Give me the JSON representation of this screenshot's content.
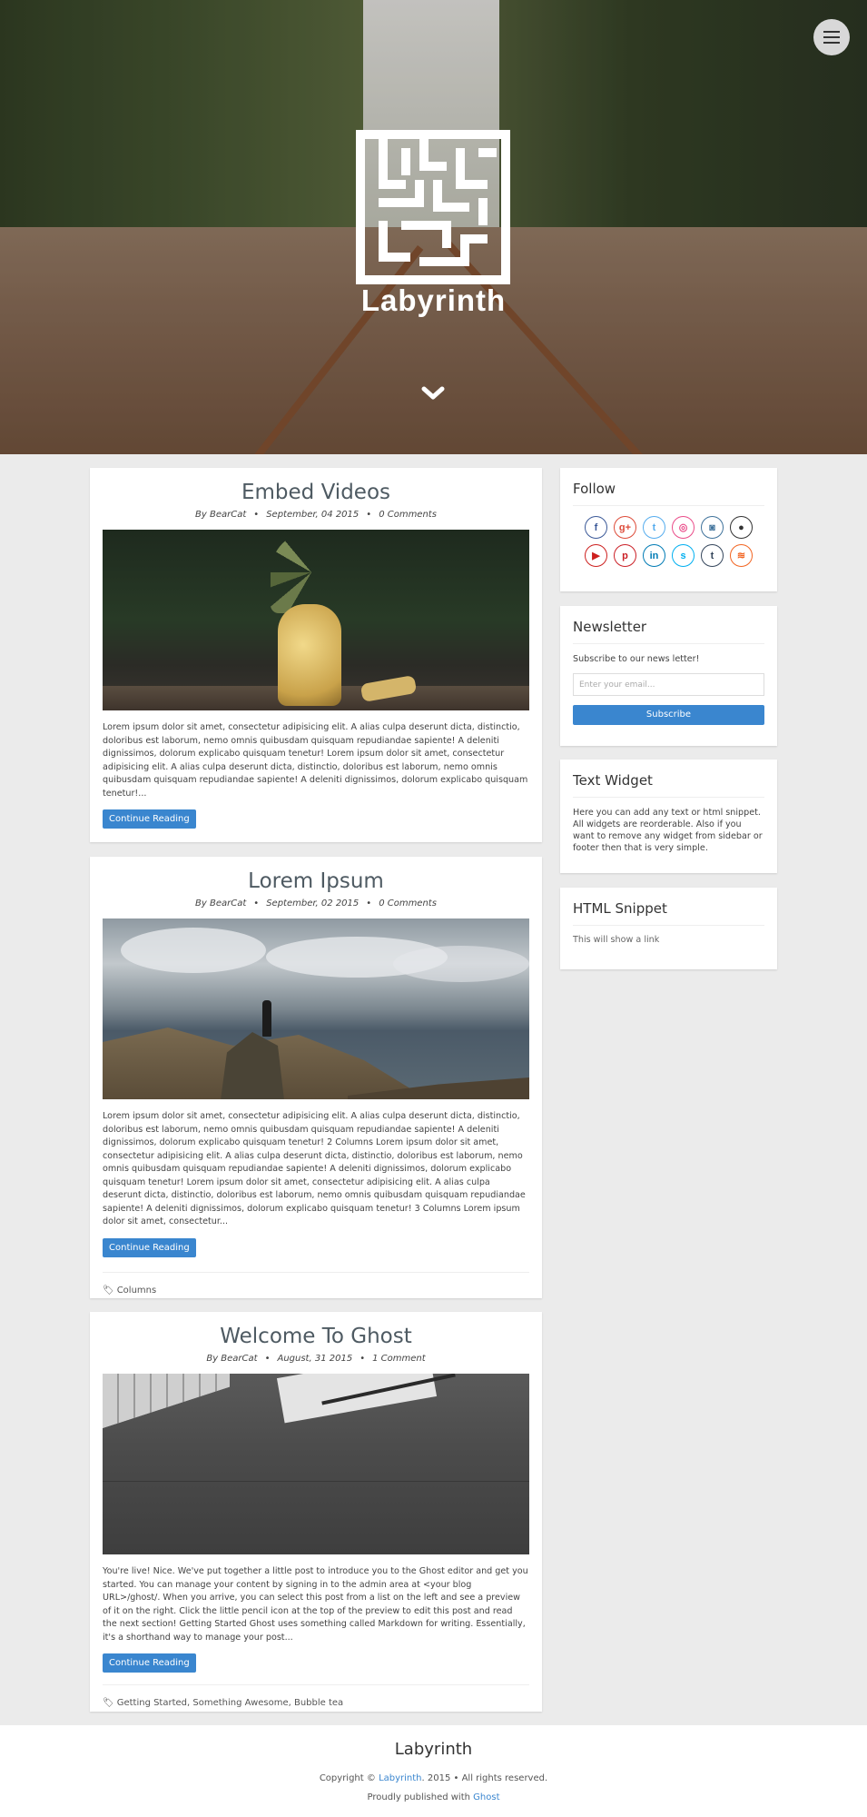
{
  "site": {
    "brand": "Labyrinth"
  },
  "posts": [
    {
      "title": "Embed Videos",
      "author": "By BearCat",
      "date": "September, 04 2015",
      "comments": "0 Comments",
      "excerpt": "Lorem ipsum dolor sit amet, consectetur adipisicing elit. A alias culpa deserunt dicta, distinctio, doloribus est laborum, nemo omnis quibusdam quisquam repudiandae sapiente! A deleniti dignissimos, dolorum explicabo quisquam tenetur! Lorem ipsum dolor sit amet, consectetur adipisicing elit. A alias culpa deserunt dicta, distinctio, doloribus est laborum, nemo omnis quibusdam quisquam repudiandae sapiente! A deleniti dignissimos, dolorum explicabo quisquam tenetur!...",
      "button": "Continue Reading"
    },
    {
      "title": "Lorem Ipsum",
      "author": "By BearCat",
      "date": "September, 02 2015",
      "comments": "0 Comments",
      "excerpt": "Lorem ipsum dolor sit amet, consectetur adipisicing elit. A alias culpa deserunt dicta, distinctio, doloribus est laborum, nemo omnis quibusdam quisquam repudiandae sapiente! A deleniti dignissimos, dolorum explicabo quisquam tenetur! 2 Columns Lorem ipsum dolor sit amet, consectetur adipisicing elit. A alias culpa deserunt dicta, distinctio, doloribus est laborum, nemo omnis quibusdam quisquam repudiandae sapiente! A deleniti dignissimos, dolorum explicabo quisquam tenetur! Lorem ipsum dolor sit amet, consectetur adipisicing elit. A alias culpa deserunt dicta, distinctio, doloribus est laborum, nemo omnis quibusdam quisquam repudiandae sapiente! A deleniti dignissimos, dolorum explicabo quisquam tenetur! 3 Columns Lorem ipsum dolor sit amet, consectetur...",
      "button": "Continue Reading",
      "tags": "Columns"
    },
    {
      "title": "Welcome To Ghost",
      "author": "By BearCat",
      "date": "August, 31 2015",
      "comments": "1 Comment",
      "excerpt": "You're live! Nice. We've put together a little post to introduce you to the Ghost editor and get you started. You can manage your content by signing in to the admin area at <your blog URL>/ghost/. When you arrive, you can select this post from a list on the left and see a preview of it on the right. Click the little pencil icon at the top of the preview to edit this post and read the next section! Getting Started Ghost uses something called Markdown for writing. Essentially, it's a shorthand way to manage your post...",
      "button": "Continue Reading",
      "tags": "Getting Started, Something Awesome, Bubble tea"
    }
  ],
  "sidebar": {
    "follow": {
      "title": "Follow",
      "icons": [
        {
          "name": "facebook-icon",
          "glyph": "f",
          "color": "#3b5998"
        },
        {
          "name": "google-plus-icon",
          "glyph": "g+",
          "color": "#dd4b39"
        },
        {
          "name": "twitter-icon",
          "glyph": "t",
          "color": "#55acee"
        },
        {
          "name": "dribbble-icon",
          "glyph": "◎",
          "color": "#ea4c89"
        },
        {
          "name": "instagram-icon",
          "glyph": "◙",
          "color": "#3f729b"
        },
        {
          "name": "github-icon",
          "glyph": "●",
          "color": "#333333"
        },
        {
          "name": "youtube-icon",
          "glyph": "▶",
          "color": "#cd201f"
        },
        {
          "name": "pinterest-icon",
          "glyph": "p",
          "color": "#cb2027"
        },
        {
          "name": "linkedin-icon",
          "glyph": "in",
          "color": "#007bb5"
        },
        {
          "name": "skype-icon",
          "glyph": "s",
          "color": "#00aff0"
        },
        {
          "name": "tumblr-icon",
          "glyph": "t",
          "color": "#35465c"
        },
        {
          "name": "rss-icon",
          "glyph": "≋",
          "color": "#f26522"
        }
      ]
    },
    "newsletter": {
      "title": "Newsletter",
      "text": "Subscribe to our news letter!",
      "placeholder": "Enter your email...",
      "button": "Subscribe"
    },
    "text_widget": {
      "title": "Text Widget",
      "text": "Here you can add any text or html snippet. All widgets are reorderable. Also if you want to remove any widget from sidebar or footer then that is very simple."
    },
    "html_snippet": {
      "title": "HTML Snippet",
      "text": "This will show a link"
    }
  },
  "footer": {
    "title": "Labyrinth",
    "copy_prefix": "Copyright ©",
    "copy_link": "Labyrinth",
    "copy_suffix": ". 2015 • All rights reserved.",
    "pub_prefix": "Proudly published with",
    "pub_link": "Ghost"
  },
  "colors": {
    "accent": "#3a86cf",
    "background": "#ebebeb"
  }
}
